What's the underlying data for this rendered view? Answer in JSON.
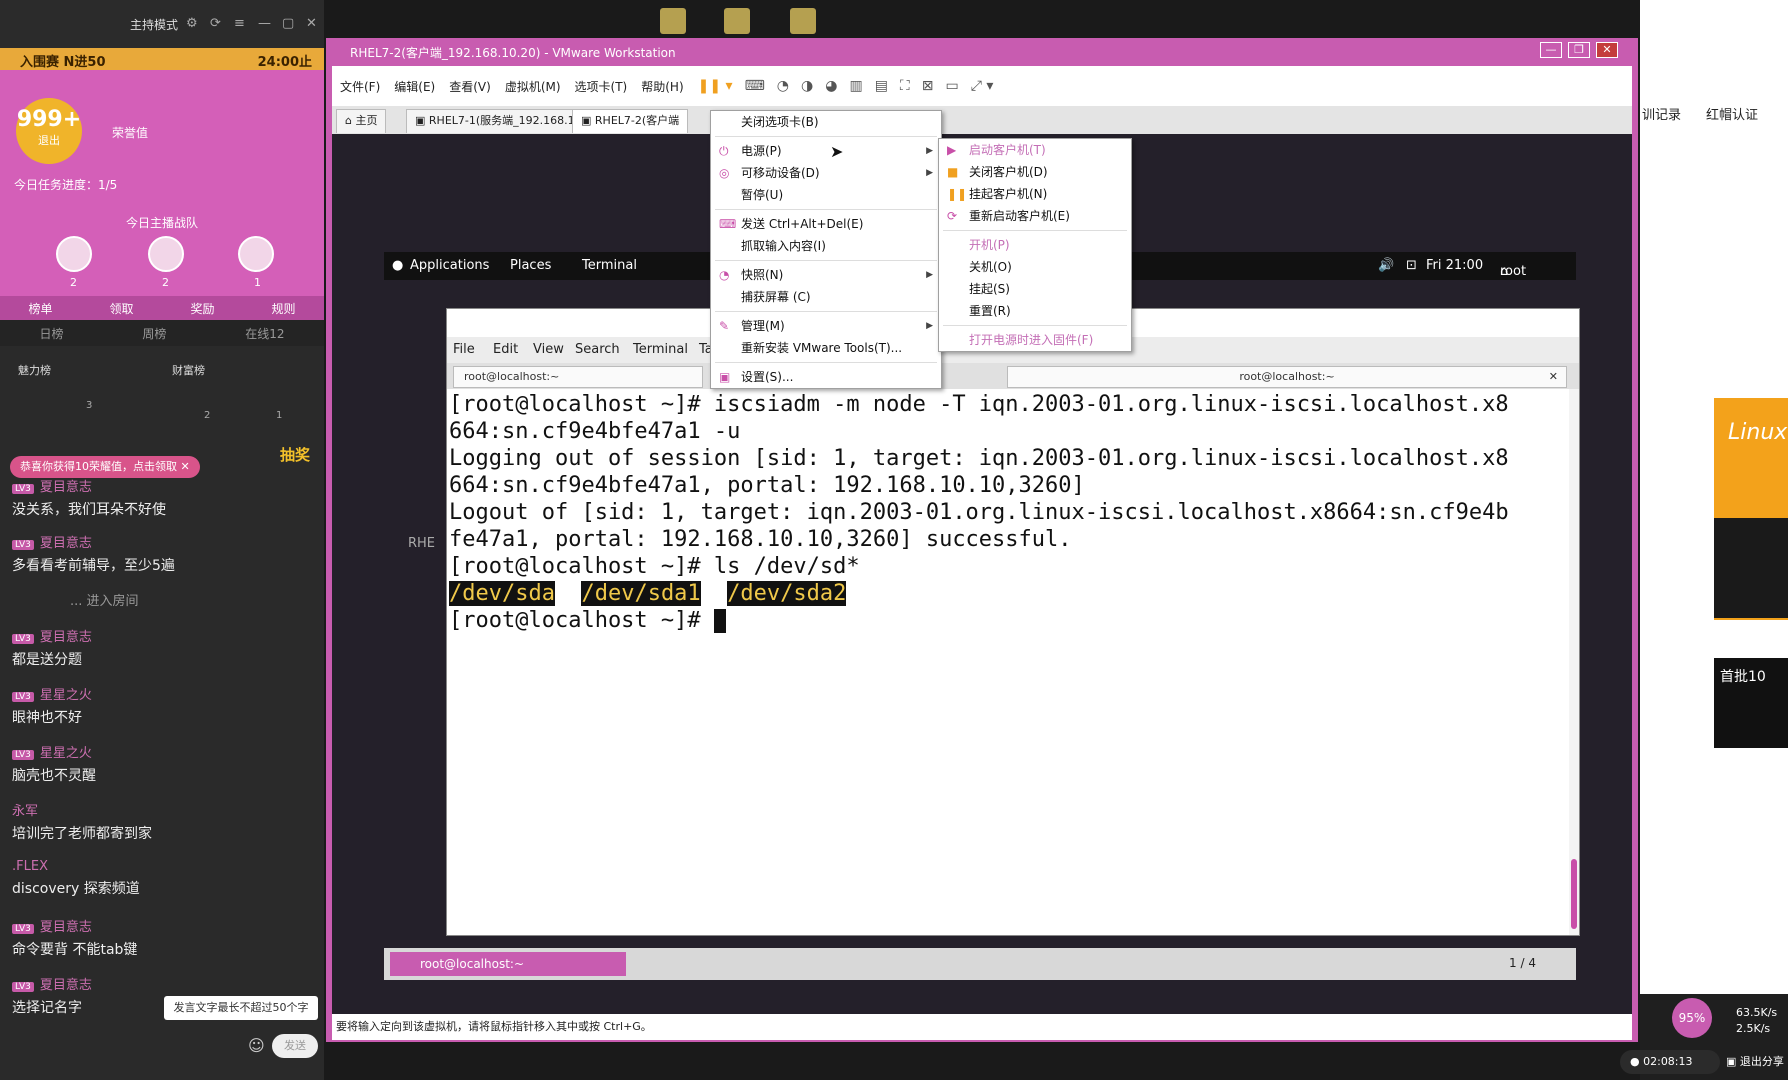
{
  "stream": {
    "mode_label": "主持模式",
    "banner_left": "入围赛 N进50",
    "banner_right": "24:00止",
    "fan_count": "999+",
    "fan_sub": "退出",
    "honor_label": "荣誉值",
    "task_progress": "今日任务进度：1/5",
    "team_label": "今日主播战队",
    "ranks": [
      {
        "n": "2"
      },
      {
        "n": "2"
      },
      {
        "n": "1"
      }
    ],
    "tabs": [
      "榜单",
      "领取",
      "奖励",
      "规则"
    ],
    "subtabs": [
      "日榜",
      "周榜",
      "在线12"
    ],
    "mini_tabs": [
      "魅力榜",
      "财富榜"
    ],
    "mini_ranks": [
      "3",
      "2",
      "1"
    ],
    "gift_toast": "恭喜你获得10荣耀值，点击领取",
    "lucky_label": "抽奖",
    "enter_room": "... 进入房间",
    "chat": [
      {
        "user": "夏目意志",
        "lv": "LV3",
        "msg": "没关系，我们耳朵不好使"
      },
      {
        "user": "夏目意志",
        "lv": "LV3",
        "msg": "多看看考前辅导，至少5遍"
      },
      {
        "user": "夏目意志",
        "lv": "LV3",
        "msg": "都是送分题"
      },
      {
        "user": "星星之火",
        "lv": "LV3",
        "msg": "眼神也不好"
      },
      {
        "user": "星星之火",
        "lv": "LV3",
        "msg": "脑壳也不灵醒"
      },
      {
        "user": "永军",
        "lv": "",
        "msg": "培训完了老师都寄到家"
      },
      {
        "user": ".FLEX",
        "lv": "",
        "msg": "discovery 探索频道"
      },
      {
        "user": "夏目意志",
        "lv": "LV3",
        "msg": "命令要背 不能tab键"
      },
      {
        "user": "夏目意志",
        "lv": "LV3",
        "msg": "选择记名字"
      }
    ],
    "input_tip": "发言文字最长不超过50个字",
    "send_label": "发送"
  },
  "vmware": {
    "title": "RHEL7-2(客户端_192.168.10.20) - VMware Workstation",
    "menus": [
      "文件(F)",
      "编辑(E)",
      "查看(V)",
      "虚拟机(M)",
      "选项卡(T)",
      "帮助(H)"
    ],
    "tabs": [
      "主页",
      "RHEL7-1(服务端_192.168.10...",
      "RHEL7-2(客户端"
    ],
    "status_text": "要将输入定向到该虚拟机，请将鼠标指针移入其中或按 Ctrl+G。",
    "vm_menu": [
      {
        "label": "关闭选项卡(B)",
        "icon": "",
        "sub": false
      },
      {
        "label": "电源(P)",
        "icon": "power-icon",
        "sub": true
      },
      {
        "label": "可移动设备(D)",
        "icon": "device-icon",
        "sub": true
      },
      {
        "label": "暂停(U)",
        "icon": "",
        "sub": false
      },
      {
        "label": "发送 Ctrl+Alt+Del(E)",
        "icon": "keyboard-icon",
        "sub": false
      },
      {
        "label": "抓取输入内容(I)",
        "icon": "",
        "sub": false
      },
      {
        "label": "快照(N)",
        "icon": "snapshot-icon",
        "sub": true
      },
      {
        "label": "捕获屏幕 (C)",
        "icon": "",
        "sub": false
      },
      {
        "label": "管理(M)",
        "icon": "wrench-icon",
        "sub": true
      },
      {
        "label": "重新安装 VMware Tools(T)...",
        "icon": "",
        "sub": false
      },
      {
        "label": "设置(S)...",
        "icon": "settings-icon",
        "sub": false
      }
    ],
    "power_menu": [
      {
        "label": "启动客户机(T)",
        "disabled": true
      },
      {
        "label": "关闭客户机(D)",
        "disabled": false
      },
      {
        "label": "挂起客户机(N)",
        "disabled": false
      },
      {
        "label": "重新启动客户机(E)",
        "disabled": false
      },
      {
        "label": "开机(P)",
        "disabled": true
      },
      {
        "label": "关机(O)",
        "disabled": false
      },
      {
        "label": "挂起(S)",
        "disabled": false
      },
      {
        "label": "重置(R)",
        "disabled": false
      },
      {
        "label": "打开电源时进入固件(F)",
        "disabled": true
      }
    ]
  },
  "guest": {
    "topbar": {
      "applications": "Applications",
      "places": "Places",
      "terminal": "Terminal",
      "clock": "Fri 21:00",
      "user": "root"
    },
    "rhel_label": "RHE",
    "term_menu": [
      "File",
      "Edit",
      "View",
      "Search",
      "Terminal",
      "Ta"
    ],
    "term_tab_left": "root@localhost:~",
    "term_tab_right": "root@localhost:~",
    "lines": [
      "[root@localhost ~]# iscsiadm -m node -T iqn.2003-01.org.linux-iscsi.localhost.x8",
      "664:sn.cf9e4bfe47a1 -u",
      "Logging out of session [sid: 1, target: iqn.2003-01.org.linux-iscsi.localhost.x8",
      "664:sn.cf9e4bfe47a1, portal: 192.168.10.10,3260]",
      "Logout of [sid: 1, target: iqn.2003-01.org.linux-iscsi.localhost.x8664:sn.cf9e4b",
      "fe47a1, portal: 192.168.10.10,3260] successful.",
      "[root@localhost ~]# ls /dev/sd*"
    ],
    "devices": [
      "/dev/sda",
      "/dev/sda1",
      "/dev/sda2"
    ],
    "prompt": "[root@localhost ~]# ",
    "taskbar_item": "root@localhost:~",
    "workspace": "1 / 4"
  },
  "right": {
    "nav": [
      "训记录",
      "红帽认证"
    ],
    "ad_title": "Linux",
    "ad2_title": "首批10",
    "percent": "95%",
    "net_up": "63.5K/s",
    "net_down": "2.5K/s",
    "time": "02:08:13",
    "exit_share": "退出分享"
  }
}
